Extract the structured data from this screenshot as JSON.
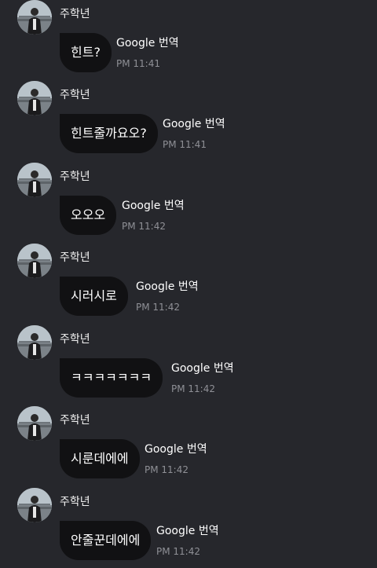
{
  "sender_name": "주학년",
  "translate_label": "Google 번역",
  "messages": [
    {
      "text": "힌트?",
      "time": "PM 11:41"
    },
    {
      "text": "힌트줄까요오?",
      "time": "PM 11:41"
    },
    {
      "text": "오오오",
      "time": "PM 11:42"
    },
    {
      "text": "시러시로",
      "time": "PM 11:42"
    },
    {
      "text": "ㅋㅋㅋㅋㅋㅋㅋ",
      "time": "PM 11:42"
    },
    {
      "text": "시룬데에에",
      "time": "PM 11:42"
    },
    {
      "text": "안줄꾼데에에",
      "time": "PM 11:42"
    }
  ]
}
